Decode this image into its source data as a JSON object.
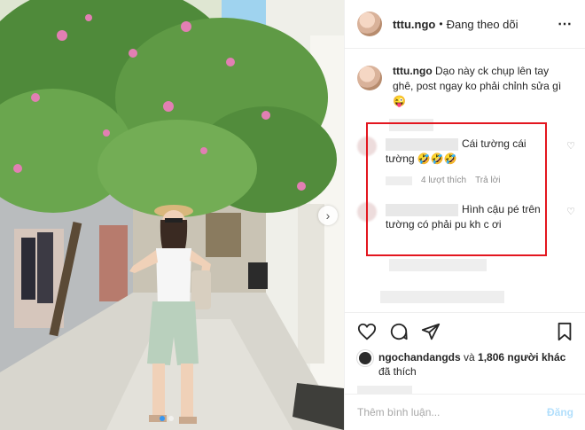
{
  "post": {
    "username": "tttu.ngo",
    "separator": "•",
    "follow_status": "Đang theo dõi",
    "more_icon": "⋯",
    "caption_user": "tttu.ngo",
    "caption_text": "Dạo này ck chụp lên tay ghê, post ngay ko phải chỉnh sửa gì 😜"
  },
  "comments": [
    {
      "text": "Cái tường cái tường 🤣🤣🤣",
      "likes": "4 lượt thích",
      "reply": "Trả lời"
    },
    {
      "text": "Hình cậu pé trên tường có phải pu kh c ơi"
    }
  ],
  "likes": {
    "user": "ngochandangds",
    "connector": "và",
    "others": "1,806 người khác",
    "suffix": "đã thích"
  },
  "add_comment": {
    "placeholder": "Thêm bình luận...",
    "post_label": "Đăng"
  },
  "colors": {
    "highlight": "#e3161f",
    "accent": "#3897f0"
  }
}
